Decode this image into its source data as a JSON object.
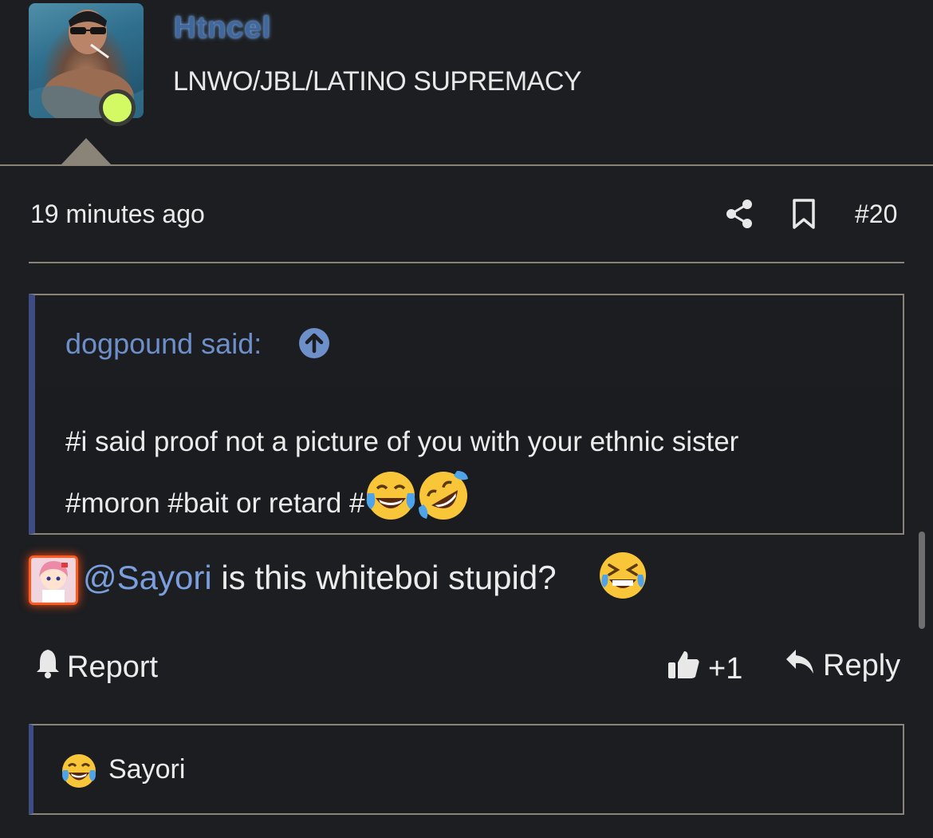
{
  "header": {
    "username": "Htncel",
    "user_title": "LNWO/JBL/LATINO SUPREMACY",
    "online_status_color": "#d4fa63",
    "username_color": "#41689c"
  },
  "post": {
    "timestamp": "19 minutes ago",
    "share_icon": "share-icon",
    "bookmark_icon": "bookmark-icon",
    "post_number": "#20"
  },
  "quote": {
    "author_label": "dogpound said:",
    "jump_icon": "arrow-up-circle-icon",
    "line1": "#i said proof not a picture of you with your ethnic sister",
    "line2": "#moron #bait or retard #",
    "emojis": [
      "face-with-tears-of-joy",
      "rolling-on-the-floor-laughing"
    ]
  },
  "message": {
    "mention": "@Sayori",
    "text": " is this whiteboi stupid?",
    "emoji": "grinning-squinting-face-with-tears"
  },
  "actions": {
    "report_label": "Report",
    "like_count": "+1",
    "reply_label": "Reply"
  },
  "reactions": {
    "emoji": "face-with-tears-of-joy",
    "user": "Sayori"
  },
  "colors": {
    "background": "#1c1e21",
    "divider": "#8a8378",
    "quote_accent": "#3d4c85",
    "link": "#7a9fdc"
  }
}
